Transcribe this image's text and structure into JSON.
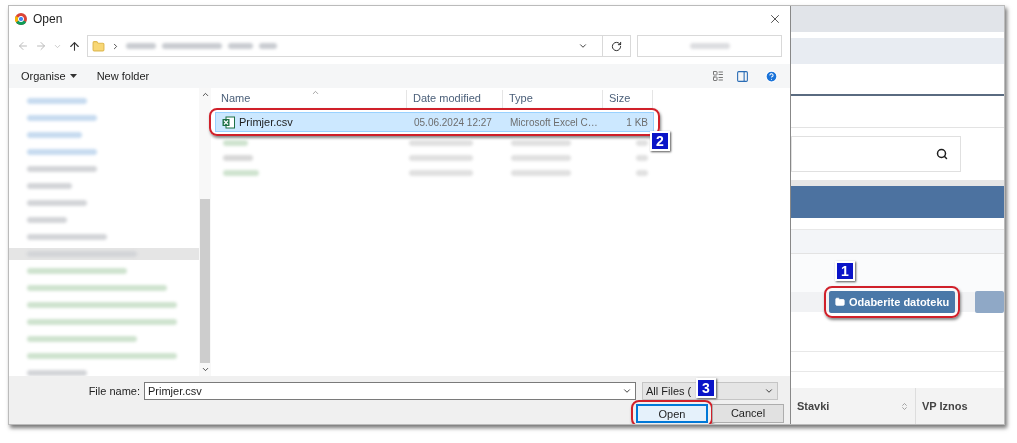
{
  "dialog": {
    "title": "Open",
    "toolbar": {
      "organise": "Organise",
      "new_folder": "New folder"
    },
    "columns": [
      "Name",
      "Date modified",
      "Type",
      "Size"
    ],
    "files": [
      {
        "name": "Primjer.csv",
        "date": "05.06.2024 12:27",
        "type": "Microsoft Excel C…",
        "size": "1 KB",
        "selected": true,
        "step": "2"
      }
    ],
    "file_name_label": "File name:",
    "file_name_value": "Primjer.csv",
    "filter": "All Files (",
    "buttons": [
      {
        "label": "Open",
        "default": true,
        "step": "3"
      },
      {
        "label": "Cancel",
        "default": false
      }
    ]
  },
  "page": {
    "upload_button": "Odaberite datoteku",
    "upload_step": "1",
    "table_columns": [
      "Stavki",
      "VP Iznos"
    ]
  }
}
